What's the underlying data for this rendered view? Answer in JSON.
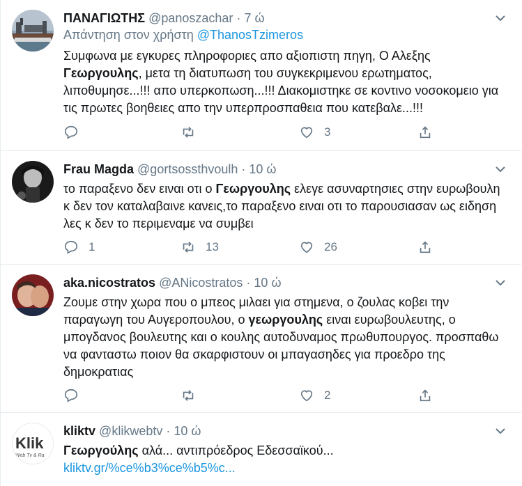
{
  "tweets": [
    {
      "name": "ΠΑΝΑΓΙΩΤΗΣ",
      "handle": "@panoszachar",
      "dot": "·",
      "time": "7 ώ",
      "reply_prefix": "Απάντηση στον χρήστη",
      "reply_user": "@ThanosTzimeros",
      "text_before": "Συμφωνα με εγκυρες πληροφοριες απο αξιοπιστη πηγη, Ο Αλεξης ",
      "text_bold": "Γεωργουλης",
      "text_after": ", μετα τη διατυπωση του συγκεκριμενου ερωτηματος, λιποθυμησε...!!! απο υπερκοπωση...!!! Διακομιστηκε σε κοντινο νοσοκομειο για τις πρωτες βοηθειες απο την υπερπροσπαθεια που κατεβαλε...!!!",
      "replies": "",
      "retweets": "",
      "likes": "3"
    },
    {
      "name": "Frau Magda",
      "handle": "@gortsossthvoulh",
      "dot": "·",
      "time": "10 ώ",
      "text_before": "το παραξενο δεν ειναι οτι ο ",
      "text_bold": "Γεωργουλης",
      "text_after": " ελεγε ασυναρτησιες στην ευρωβουλη κ δεν τον καταλαβαινε κανεις,το παραξενο ειναι οτι το παρουσιασαν ως ειδηση λες κ δεν το περιμεναμε να συμβει",
      "replies": "1",
      "retweets": "13",
      "likes": "26"
    },
    {
      "name": "aka.nicostratos",
      "handle": "@ANicostratos",
      "dot": "·",
      "time": "10 ώ",
      "text_before": "Ζουμε στην χωρα που ο μπεος μιλαει για στημενα, ο ζουλας κοβει την παραγωγη του Αυγεροπουλου, ο ",
      "text_bold": "γεωργουλης",
      "text_after": " ειναι ευρωβουλευτης, ο μπογδανος βουλευτης και ο κουλης αυτοδυναμος πρωθυπουργος. προσπαθω να φανταστω ποιον θα σκαρφιστουν οι μπαγασηδες για προεδρο της δημοκρατιας",
      "replies": "",
      "retweets": "",
      "likes": "2"
    },
    {
      "name": "kliktv",
      "handle": "@klikwebtv",
      "dot": "·",
      "time": "10 ώ",
      "text_before": "",
      "text_bold": "Γεωργούλης",
      "text_after": " αλά... αντιπρόεδρος Εδεσσαϊκού... ",
      "link": "kliktv.gr/%ce%b3%ce%b5%c...",
      "avatar_logo": "Klik",
      "avatar_sub": "Web Tv & Ra"
    }
  ],
  "colors": {
    "link": "#1b95e0",
    "muted": "#657786",
    "border": "#e6ecf0"
  }
}
